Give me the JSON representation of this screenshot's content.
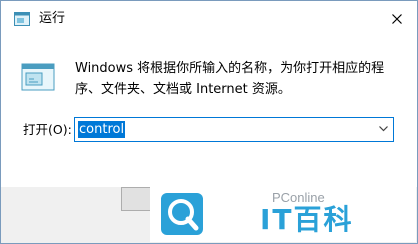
{
  "window": {
    "title": "运行"
  },
  "dialog": {
    "description": "Windows 将根据你所输入的名称，为你打开相应的程序、文件夹、文档或 Internet 资源。",
    "open_label": "打开(O):",
    "open_value": "control"
  },
  "watermark": {
    "brand": "PConline",
    "name": "IT百科"
  },
  "icons": [
    "run-icon",
    "close-icon",
    "run-program-icon",
    "chevron-down-icon",
    "pconline-logo-icon"
  ],
  "colors": {
    "accent": "#0078d7",
    "watermark_blue": "#2aa1d8",
    "footer_bg": "#f0f0f0"
  }
}
